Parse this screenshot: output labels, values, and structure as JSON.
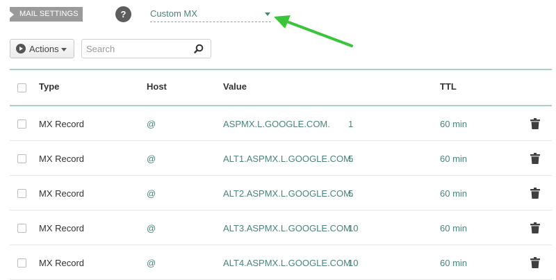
{
  "header": {
    "section_label": "MAIL SETTINGS",
    "help_label": "?",
    "mail_type_selected": "Custom MX"
  },
  "toolbar": {
    "actions_label": "Actions",
    "search_placeholder": "Search"
  },
  "table": {
    "columns": [
      "Type",
      "Host",
      "Value",
      "TTL"
    ],
    "rows": [
      {
        "type": "MX Record",
        "host": "@",
        "value": "ASPMX.L.GOOGLE.COM.",
        "priority": "1",
        "ttl": "60 min"
      },
      {
        "type": "MX Record",
        "host": "@",
        "value": "ALT1.ASPMX.L.GOOGLE.COM.",
        "priority": "5",
        "ttl": "60 min"
      },
      {
        "type": "MX Record",
        "host": "@",
        "value": "ALT2.ASPMX.L.GOOGLE.COM.",
        "priority": "5",
        "ttl": "60 min"
      },
      {
        "type": "MX Record",
        "host": "@",
        "value": "ALT3.ASPMX.L.GOOGLE.COM.",
        "priority": "10",
        "ttl": "60 min"
      },
      {
        "type": "MX Record",
        "host": "@",
        "value": "ALT4.ASPMX.L.GOOGLE.COM.",
        "priority": "10",
        "ttl": "60 min"
      }
    ]
  },
  "icons": {
    "help": "help-icon",
    "actions": "play-icon",
    "search": "search-icon",
    "delete": "trash-icon",
    "annotation": "arrow-icon"
  },
  "colors": {
    "accent": "#4a837b",
    "table_border": "#a9cfc9",
    "annotation_arrow": "#39c43a",
    "section_tag": "#9a9a9a"
  }
}
